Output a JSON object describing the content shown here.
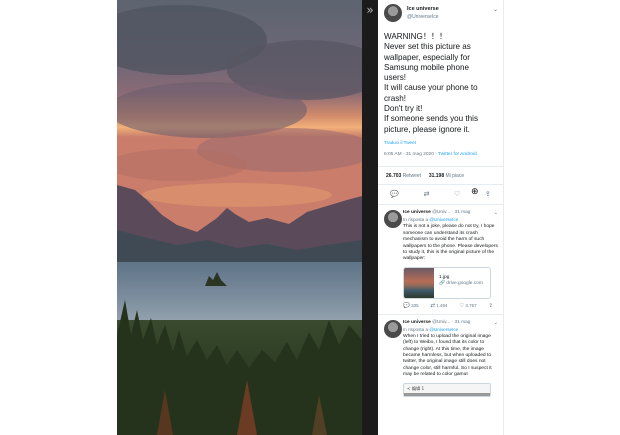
{
  "strip": {
    "arrow_icon": "»"
  },
  "tweet": {
    "author": "Ice universe",
    "handle": "@UniverseIce",
    "menu_icon": "chevron-down",
    "lines": [
      "WARNING！！！",
      "Never set this picture as",
      "wallpaper, especially for",
      "Samsung mobile phone",
      "users!",
      "It will cause your phone to",
      "crash!",
      "Don't try it!",
      "If someone sends you this",
      "picture, please ignore it."
    ],
    "translate": "Traduci il Tweet",
    "timestamp": "6:05 AM · 31 mag 2020 · ",
    "source": "Twitter for Android",
    "retweets_count": "26.703",
    "retweets_label": "Retweet",
    "likes_count": "31.198",
    "likes_label": "Mi piace"
  },
  "actions": {
    "reply": "💬",
    "retweet": "⇄",
    "like": "♡",
    "share": "⇪"
  },
  "replies": [
    {
      "author": "Ice universe",
      "handle": "@Univ...",
      "date": "· 31 mag",
      "in_reply_prefix": "In risposta a",
      "in_reply_handle": "@UniverseIce",
      "text": "This is not a joke, please do not try, I hope someone can understand its crash mechanism to avoid the harm of such wallpapers to the phone. Please developers to study it, this is the original picture of the wallpaper:",
      "card_title": "1.jpg",
      "card_domain": "drive.google.com",
      "replies_count": "335",
      "retweets_count": "1.494",
      "likes_count": "3.767"
    },
    {
      "author": "Ice universe",
      "handle": "@Univ...",
      "date": "· 31 mag",
      "in_reply_prefix": "In risposta a",
      "in_reply_handle": "@UniverseIce",
      "text": "When I tried to upload the original image (left) to Weibo, I found that its color to change (right). At this time, the image became harmless, but when uploaded to twitter, the original image still does not change color, still harmful. So I suspect it may be related to color gamut",
      "shot_label": "< 编辑 1"
    }
  ]
}
